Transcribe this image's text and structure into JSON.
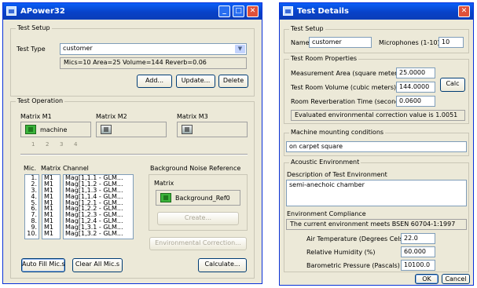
{
  "left_window": {
    "title": "APower32",
    "title_buttons": {
      "minimize": "_",
      "maximize": "□",
      "close": "✕"
    },
    "test_setup": {
      "group_title": "Test Setup",
      "test_type_label": "Test Type",
      "test_type_value": "customer",
      "summary": "Mics=10  Area=25  Volume=144  Reverb=0.06",
      "buttons": {
        "add": "Add...",
        "update": "Update...",
        "delete": "Delete"
      }
    },
    "test_operation": {
      "group_title": "Test Operation",
      "matrices": [
        {
          "label": "Matrix M1",
          "name": "machine"
        },
        {
          "label": "Matrix M2",
          "name": ""
        },
        {
          "label": "Matrix M3",
          "name": ""
        }
      ],
      "position_numbers": [
        "1",
        "2",
        "3",
        "4"
      ],
      "columns": {
        "mic": "Mic.",
        "matrix": "Matrix",
        "channel": "Channel"
      },
      "mic_numbers": [
        "1.",
        "2.",
        "3.",
        "4.",
        "5.",
        "6.",
        "7.",
        "8.",
        "9.",
        "10."
      ],
      "mic_matrices": [
        "M1",
        "M1",
        "M1",
        "M1",
        "M1",
        "M1",
        "M1",
        "M1",
        "M1",
        "M1"
      ],
      "mic_channels": [
        "Mag[1,1.1 - GLM...",
        "Mag[1,1.2 - GLM...",
        "Mag[1,1.3 - GLM...",
        "Mag[1,1.4 - GLM...",
        "Mag[1,2.1 - GLM...",
        "Mag[1,2.2 - GLM...",
        "Mag[1,2.3 - GLM...",
        "Mag[1,2.4 - GLM...",
        "Mag[1,3.1 - GLM...",
        "Mag[1,3.2 - GLM..."
      ],
      "bg_noise": {
        "title": "Background Noise Reference",
        "matrix_label": "Matrix",
        "name": "Background_Ref0",
        "create_button": "Create..."
      },
      "env_correction_button": "Environmental Correction...",
      "buttons": {
        "auto_fill": "Auto Fill Mic.s",
        "clear_all": "Clear All Mic.s",
        "calculate": "Calculate..."
      }
    }
  },
  "right_window": {
    "title": "Test Details",
    "test_setup": {
      "group_title": "Test Setup",
      "name_label": "Name",
      "name_value": "customer",
      "mics_label": "Microphones (1-10)",
      "mics_value": "10"
    },
    "room": {
      "group_title": "Test Room Properties",
      "area_label": "Measurement Area (square meters)",
      "area_value": "25.0000",
      "volume_label": "Test Room Volume (cubic meters)",
      "volume_value": "144.0000",
      "reverb_label": "Room Reverberation Time (seconds)",
      "reverb_value": "0.0600",
      "calc_button": "Calc",
      "evaluated_text": "Evaluated environmental correction value is 1.0051"
    },
    "machine_mounting": {
      "group_title": "Machine mounting conditions",
      "value": "on carpet square"
    },
    "acoustic": {
      "group_title": "Acoustic Environment",
      "desc_label": "Description of Test Environment",
      "desc_value": "semi-anechoic chamber",
      "compliance_label": "Environment Compliance",
      "compliance_text": "The current environment meets BSEN 60704-1:1997",
      "air_temp_label": "Air Temperature (Degrees Celsius)",
      "air_temp_value": "22.0",
      "humidity_label": "Relative Humidity (%)",
      "humidity_value": "60.000",
      "pressure_label": "Barometric Pressure (Pascals)",
      "pressure_value": "10100.0"
    },
    "buttons": {
      "ok": "OK",
      "cancel": "Cancel"
    }
  }
}
